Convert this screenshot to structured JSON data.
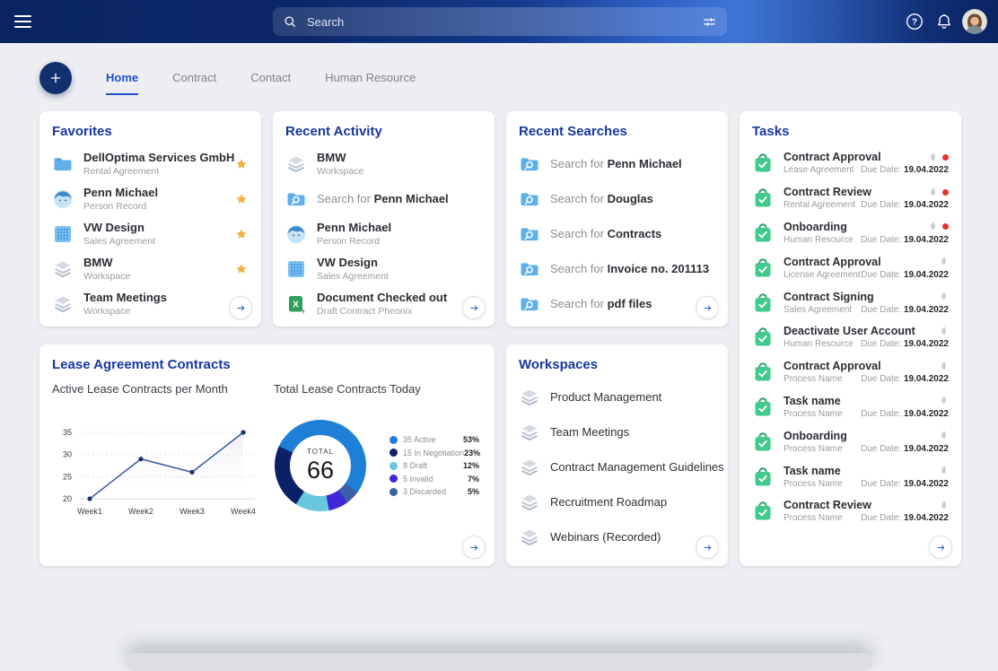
{
  "topbar": {
    "search_placeholder": "Search"
  },
  "nav_tabs": {
    "items": [
      {
        "label": "Home",
        "active": true
      },
      {
        "label": "Contract",
        "active": false
      },
      {
        "label": "Contact",
        "active": false
      },
      {
        "label": "Human Resource",
        "active": false
      }
    ]
  },
  "favorites": {
    "title": "Favorites",
    "items": [
      {
        "title": "DellOptima Services GmbH",
        "subtitle": "Rental Agreement",
        "icon": "folder-icon"
      },
      {
        "title": "Penn Michael",
        "subtitle": "Person Record",
        "icon": "person-icon"
      },
      {
        "title": "VW Design",
        "subtitle": "Sales Agreement",
        "icon": "grid-icon"
      },
      {
        "title": "BMW",
        "subtitle": "Workspace",
        "icon": "layers-icon"
      },
      {
        "title": "Team Meetings",
        "subtitle": "Workspace",
        "icon": "layers-icon"
      }
    ]
  },
  "recent_activity": {
    "title": "Recent Activity",
    "items": [
      {
        "title": "BMW",
        "subtitle": "Workspace",
        "icon": "layers-icon"
      },
      {
        "prefix": "Search for ",
        "term": "Penn Michael",
        "icon": "search-folder-icon"
      },
      {
        "title": "Penn Michael",
        "subtitle": "Person Record",
        "icon": "person-icon"
      },
      {
        "title": "VW Design",
        "subtitle": "Sales Agreement",
        "icon": "grid-icon"
      },
      {
        "title": "Document Checked out",
        "subtitle": "Draft Contract Pheonix",
        "icon": "excel-icon"
      }
    ]
  },
  "recent_searches": {
    "title": "Recent Searches",
    "items": [
      {
        "prefix": "Search for ",
        "term": "Penn Michael"
      },
      {
        "prefix": "Search for ",
        "term": "Douglas"
      },
      {
        "prefix": "Search for ",
        "term": "Contracts"
      },
      {
        "prefix": "Search for ",
        "term": "Invoice no. 201113"
      },
      {
        "prefix": "Search for ",
        "term": "pdf files"
      }
    ]
  },
  "tasks": {
    "title": "Tasks",
    "due_label": "Due Date: ",
    "items": [
      {
        "title": "Contract Approval",
        "subtitle": "Lease Agreement",
        "due": "19.04.2022",
        "alert": true
      },
      {
        "title": "Contract Review",
        "subtitle": "Rental Agreement",
        "due": "19.04.2022",
        "alert": true
      },
      {
        "title": "Onboarding",
        "subtitle": "Human Resource",
        "due": "19.04.2022",
        "alert": true
      },
      {
        "title": "Contract Approval",
        "subtitle": "License Agreement",
        "due": "19.04.2022",
        "alert": false
      },
      {
        "title": "Contract Signing",
        "subtitle": "Sales Agreement",
        "due": "19.04.2022",
        "alert": false
      },
      {
        "title": "Deactivate User Account",
        "subtitle": "Human Resource",
        "due": "19.04.2022",
        "alert": false
      },
      {
        "title": "Contract Approval",
        "subtitle": "Process Name",
        "due": "19.04.2022",
        "alert": false
      },
      {
        "title": "Task name",
        "subtitle": "Process Name",
        "due": "19.04.2022",
        "alert": false
      },
      {
        "title": "Onboarding",
        "subtitle": "Process Name",
        "due": "19.04.2022",
        "alert": false
      },
      {
        "title": "Task name",
        "subtitle": "Process Name",
        "due": "19.04.2022",
        "alert": false
      },
      {
        "title": "Contract Review",
        "subtitle": "Process Name",
        "due": "19.04.2022",
        "alert": false
      }
    ]
  },
  "lease_section": {
    "title": "Lease Agreement Contracts"
  },
  "workspaces": {
    "title": "Workspaces",
    "items": [
      {
        "title": "Product Management"
      },
      {
        "title": "Team Meetings"
      },
      {
        "title": "Contract Management Guidelines"
      },
      {
        "title": "Recruitment Roadmap"
      },
      {
        "title": "Webinars (Recorded)"
      }
    ]
  },
  "chart_data": [
    {
      "type": "line",
      "title": "Active Lease Contracts per Month",
      "x": [
        "Week1",
        "Week2",
        "Week3",
        "Week4"
      ],
      "values": [
        20,
        29,
        26,
        35
      ],
      "yticks": [
        35,
        30,
        25,
        20
      ],
      "ylim": [
        20,
        35
      ],
      "grid": true,
      "line_color": "#3a57a8"
    },
    {
      "type": "pie",
      "title": "Total Lease Contracts Today",
      "center_label": "TOTAL",
      "total": 66,
      "legend_position": "right",
      "start_angle": -65,
      "draw_order": [
        0,
        4,
        3,
        2,
        1
      ],
      "slices": [
        {
          "label": "35 Active",
          "value": 35,
          "pct": "53%",
          "color": "#1e7fd6"
        },
        {
          "label": "15 In Negotiation",
          "value": 15,
          "pct": "23%",
          "color": "#0b2066"
        },
        {
          "label": "8 Draft",
          "value": 8,
          "pct": "12%",
          "color": "#66c7dd"
        },
        {
          "label": "5 Invalid",
          "value": 5,
          "pct": "7%",
          "color": "#4226d9"
        },
        {
          "label": "3 Discarded",
          "value": 3,
          "pct": "5%",
          "color": "#3d5fa6"
        }
      ]
    }
  ]
}
